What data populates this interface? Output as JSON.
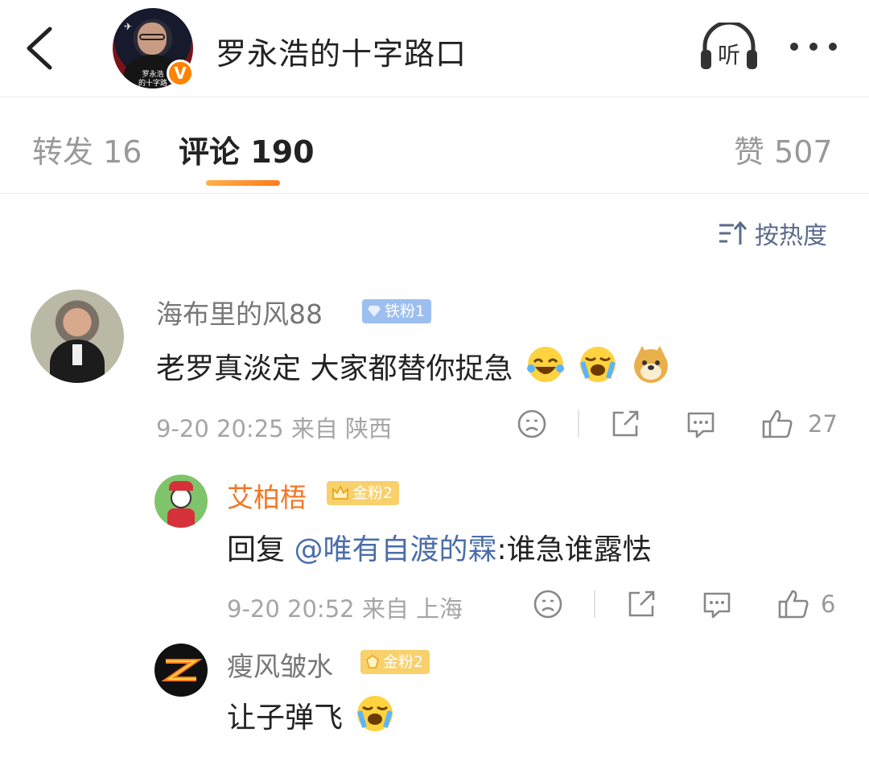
{
  "header": {
    "title": "罗永浩的十字路口",
    "avatar_caption": "罗永浩\n的十字路",
    "verified_badge": "V",
    "listen_label": "听"
  },
  "tabs": [
    {
      "label": "转发",
      "count": "16"
    },
    {
      "label": "评论",
      "count": "190"
    },
    {
      "label": "赞",
      "count": "507"
    }
  ],
  "sort": {
    "label": "按热度"
  },
  "comments": [
    {
      "user": "海布里的风88",
      "badge": "铁粉1",
      "text": "老罗真淡定 大家都替你捉急",
      "emojis": [
        "laughing-crying-emoji",
        "wailing-emoji",
        "doge-emoji"
      ],
      "time": "9-20 20:25",
      "location": "来自 陕西",
      "likes": "27"
    },
    {
      "user": "艾柏梧",
      "badge": "金粉2",
      "reply_prefix": "回复 ",
      "mention": "@唯有自渡的霖",
      "text": ":谁急谁露怯",
      "time": "9-20 20:52",
      "location": "来自 上海",
      "likes": "6"
    },
    {
      "user": "瘦风皱水",
      "badge": "金粉2",
      "text": "让子弹飞",
      "emojis": [
        "wailing-emoji"
      ]
    }
  ],
  "colors": {
    "orange": "#ff8200",
    "link": "#4a6ea9",
    "tab_underline": "#ff8c2b"
  }
}
